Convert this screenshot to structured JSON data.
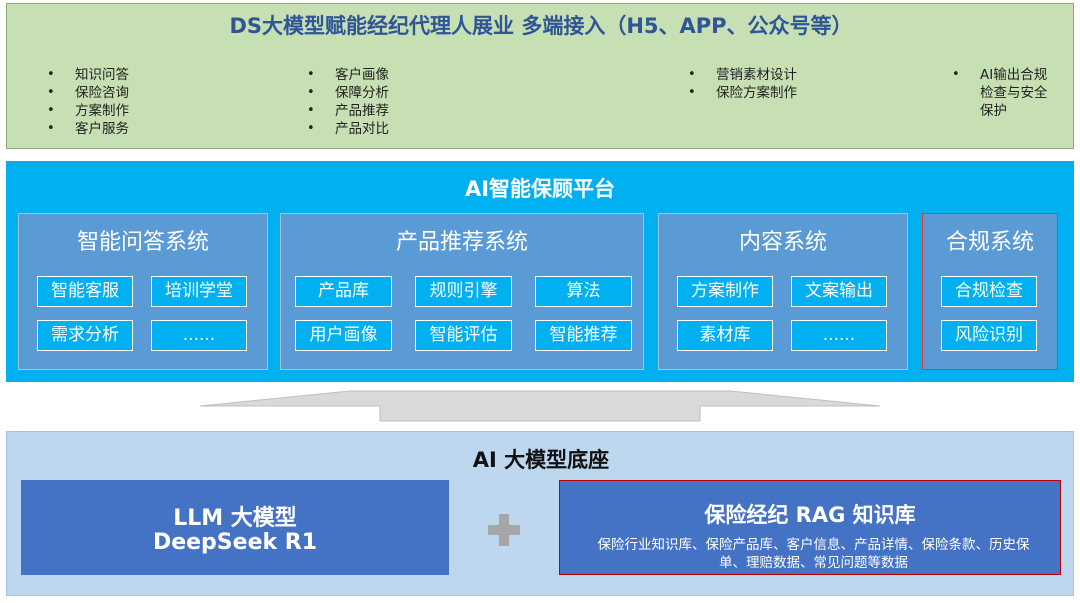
{
  "top": {
    "title": "DS大模型赋能经纪代理人展业   多端接入（H5、APP、公众号等）",
    "columns": [
      [
        "知识问答",
        "保险咨询",
        "方案制作",
        "客户服务"
      ],
      [
        "客户画像",
        "保障分析",
        "产品推荐",
        "产品对比"
      ],
      [
        "营销素材设计",
        "保险方案制作"
      ],
      [
        "AI输出合规检查与安全保护"
      ]
    ]
  },
  "platform": {
    "title": "AI智能保顾平台",
    "systems": [
      {
        "title": "智能问答系统",
        "items": [
          "智能客服",
          "培训学堂",
          "需求分析",
          "......"
        ]
      },
      {
        "title": "产品推荐系统",
        "items": [
          "产品库",
          "规则引擎",
          "算法",
          "用户画像",
          "智能评估",
          "智能推荐"
        ]
      },
      {
        "title": "内容系统",
        "items": [
          "方案制作",
          "文案输出",
          "素材库",
          "......"
        ]
      },
      {
        "title": "合规系统",
        "items": [
          "合规检查",
          "风险识别"
        ]
      }
    ]
  },
  "base": {
    "title": "AI 大模型底座",
    "llm": {
      "line1": "LLM 大模型",
      "line2": "DeepSeek R1"
    },
    "rag": {
      "title": "保险经纪 RAG 知识库",
      "desc": "保险行业知识库、保险产品库、客户信息、产品详情、保险条款、历史保单、理赔数据、常见问题等数据"
    }
  },
  "colors": {
    "top_bg": "#c6e0b4",
    "platform_bg": "#00b0f0",
    "system_bg": "#5b9bd5",
    "base_bg": "#bdd7ee",
    "box_bg": "#4472c4",
    "highlight": "#e03a3a"
  }
}
